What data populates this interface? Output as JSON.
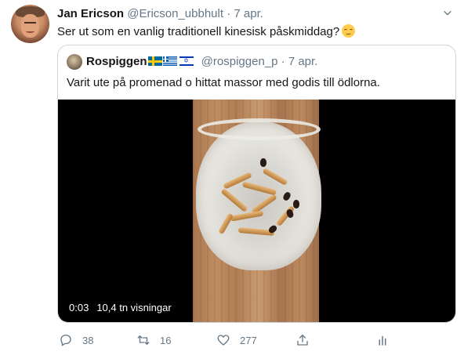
{
  "tweet": {
    "author_name": "Jan Ericson",
    "author_handle": "@Ericson_ubbhult",
    "separator": "·",
    "timestamp": "7 apr.",
    "text": "Ser ut som en vanlig traditionell kinesisk påskmiddag?",
    "text_emoji": "relieved-face-emoji"
  },
  "quoted_tweet": {
    "author_name": "Rospiggen",
    "flags": [
      "sweden-flag-icon",
      "greece-flag-icon",
      "israel-flag-icon"
    ],
    "author_handle": "@rospiggen_p",
    "separator": "·",
    "timestamp": "7 apr.",
    "text": "Varit ute på promenad o hittat massor med godis till ödlorna.",
    "video": {
      "duration": "0:03",
      "views": "10,4 tn visningar"
    }
  },
  "actions": {
    "reply_count": "38",
    "retweet_count": "16",
    "like_count": "277",
    "share_icon": "share-icon",
    "analytics_icon": "analytics-icon"
  },
  "colors": {
    "text_primary": "#14171a",
    "text_secondary": "#657786",
    "border": "#ccd6dd",
    "video_bg": "#000000"
  }
}
